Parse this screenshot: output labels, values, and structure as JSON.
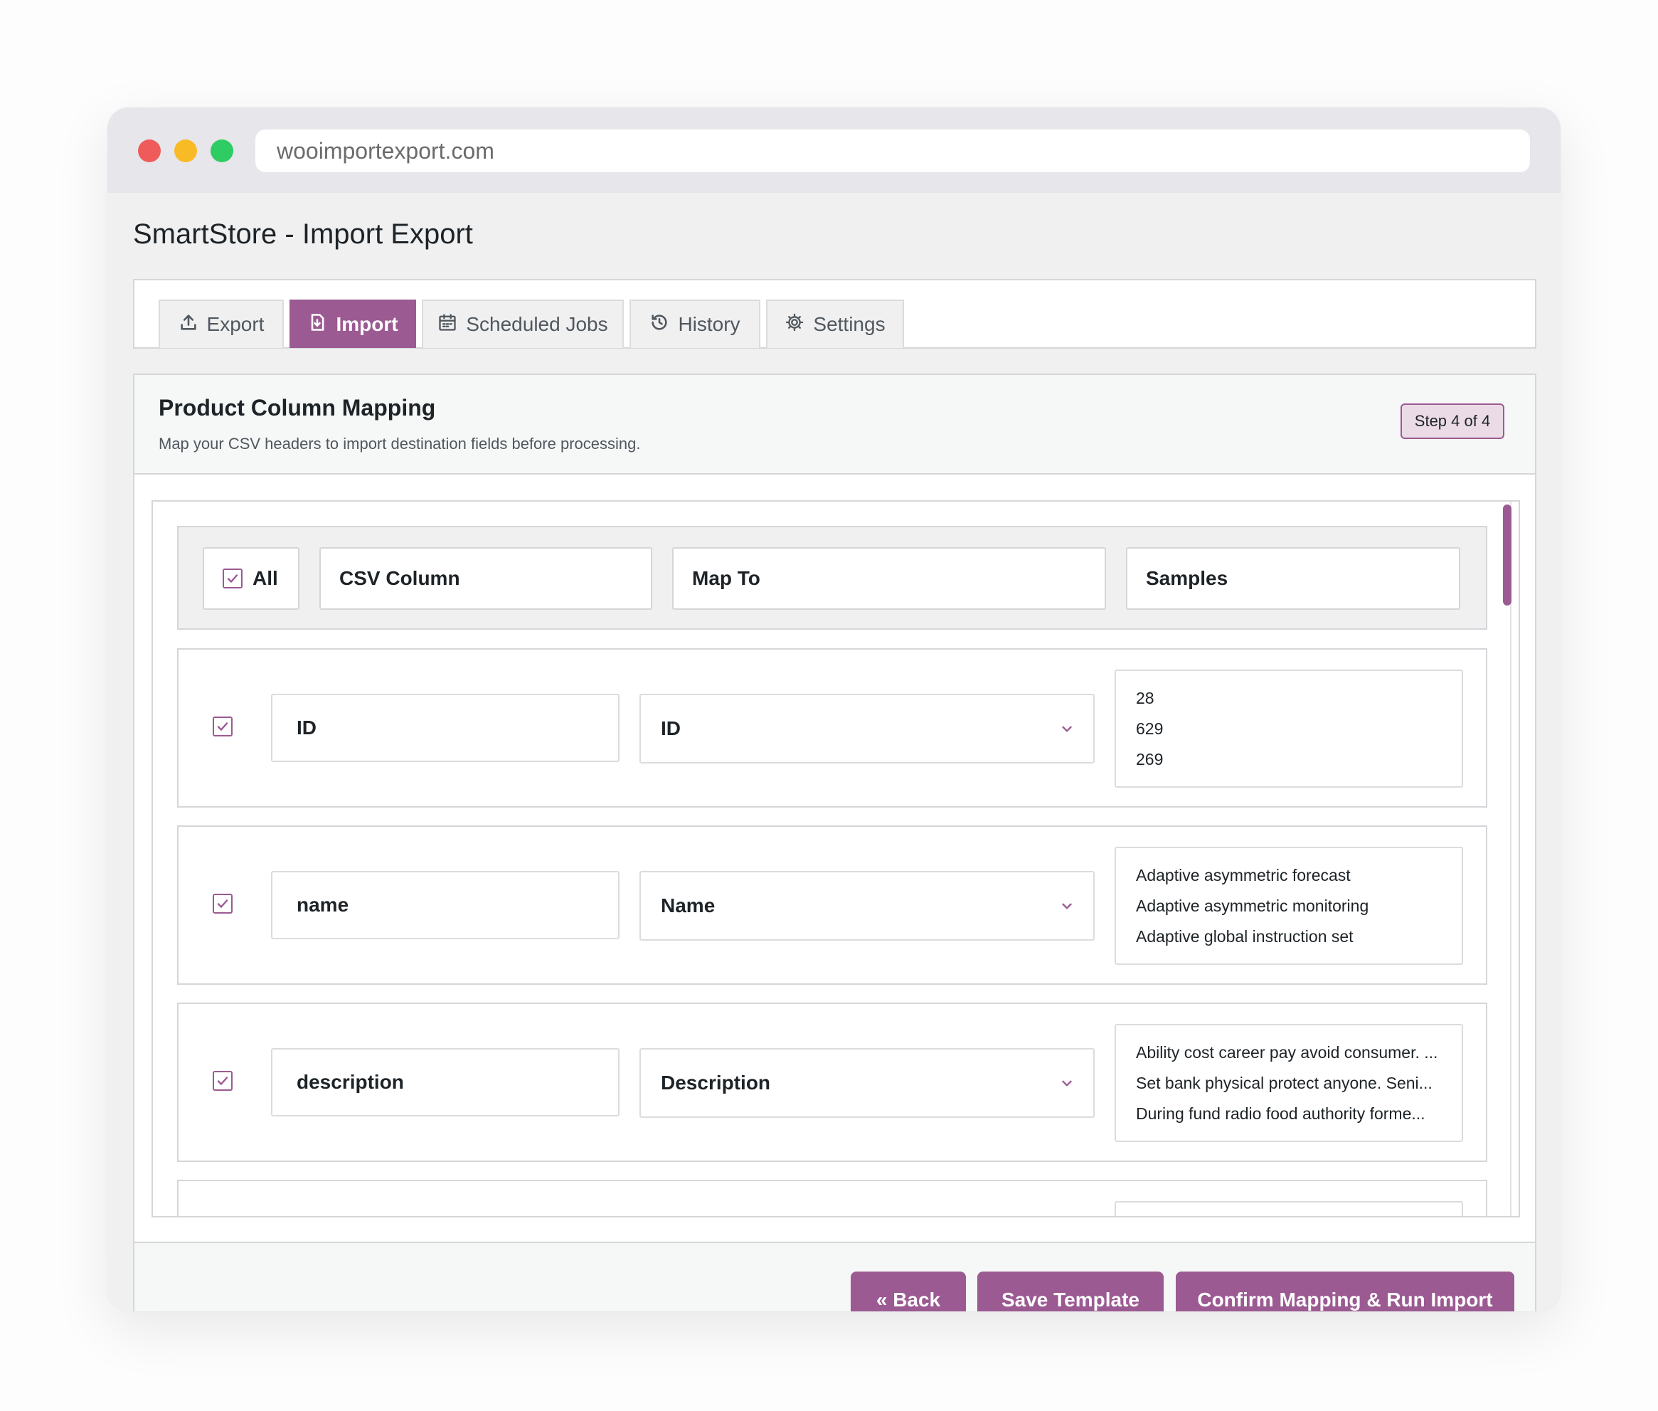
{
  "browser": {
    "url": "wooimportexport.com"
  },
  "app": {
    "title": "SmartStore - Import Export"
  },
  "tabs": [
    {
      "label": "Export",
      "icon": "upload-icon"
    },
    {
      "label": "Import",
      "icon": "file-import-icon"
    },
    {
      "label": "Scheduled Jobs",
      "icon": "calendar-icon"
    },
    {
      "label": "History",
      "icon": "history-icon"
    },
    {
      "label": "Settings",
      "icon": "gear-icon"
    }
  ],
  "active_tab": "Import",
  "panel": {
    "title": "Product Column Mapping",
    "subtitle": "Map your CSV headers to import destination fields before processing.",
    "step": "Step 4 of 4"
  },
  "table_header": {
    "all": "All",
    "csv_column": "CSV Column",
    "map_to": "Map To",
    "samples": "Samples"
  },
  "rows": [
    {
      "checked": true,
      "csv": "ID",
      "map": "ID",
      "samples": [
        "28",
        "629",
        "269"
      ]
    },
    {
      "checked": true,
      "csv": "name",
      "map": "Name",
      "samples": [
        "Adaptive asymmetric forecast",
        "Adaptive asymmetric monitoring",
        "Adaptive global instruction set"
      ]
    },
    {
      "checked": true,
      "csv": "description",
      "map": "Description",
      "samples": [
        "Ability cost career pay avoid consumer. ...",
        "Set bank physical protect anyone. Seni...",
        "During fund radio food authority forme..."
      ]
    }
  ],
  "buttons": {
    "back": "« Back",
    "save_template": "Save Template",
    "confirm": "Confirm Mapping & Run Import"
  },
  "colors": {
    "accent": "#9b5a92",
    "accent_light": "#eadbe7"
  }
}
